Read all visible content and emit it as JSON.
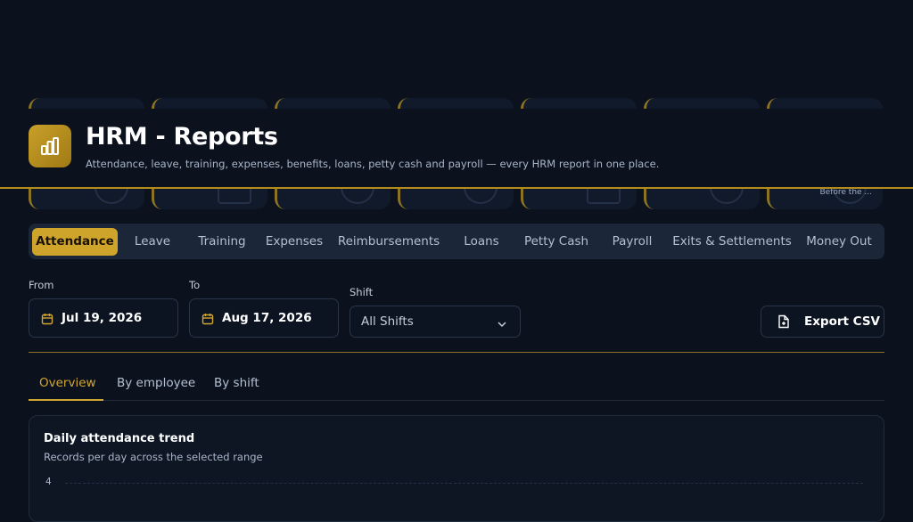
{
  "header": {
    "title": "HRM - Reports",
    "subtitle": "Attendance, leave, training, expenses, benefits, loans, petty cash and payroll — every HRM report in one place.",
    "icon": "bar-chart-icon",
    "accent_color": "#cfa42b"
  },
  "stat_cards": [
    {
      "caption": ""
    },
    {
      "caption": ""
    },
    {
      "caption": ""
    },
    {
      "caption": ""
    },
    {
      "caption": ""
    },
    {
      "caption": ""
    },
    {
      "caption": "Before the ..."
    }
  ],
  "report_tabs": [
    {
      "label": "Attendance",
      "active": true
    },
    {
      "label": "Leave"
    },
    {
      "label": "Training"
    },
    {
      "label": "Expenses"
    },
    {
      "label": "Reimbursements"
    },
    {
      "label": "Loans"
    },
    {
      "label": "Petty Cash"
    },
    {
      "label": "Payroll"
    },
    {
      "label": "Exits & Settlements"
    },
    {
      "label": "Money Out"
    }
  ],
  "filters": {
    "from_label": "From",
    "from_value": "Jul 19, 2026",
    "to_label": "To",
    "to_value": "Aug 17, 2026",
    "shift_label": "Shift",
    "shift_value": "All Shifts",
    "export_label": "Export CSV"
  },
  "view_tabs": [
    {
      "label": "Overview",
      "active": true
    },
    {
      "label": "By employee"
    },
    {
      "label": "By shift"
    }
  ],
  "chart": {
    "title": "Daily attendance trend",
    "subtitle": "Records per day across the selected range",
    "y_tick_top": "4"
  },
  "chart_data": {
    "type": "line",
    "title": "Daily attendance trend",
    "subtitle": "Records per day across the selected range",
    "y_ticks": [
      "4"
    ],
    "grid": true
  }
}
